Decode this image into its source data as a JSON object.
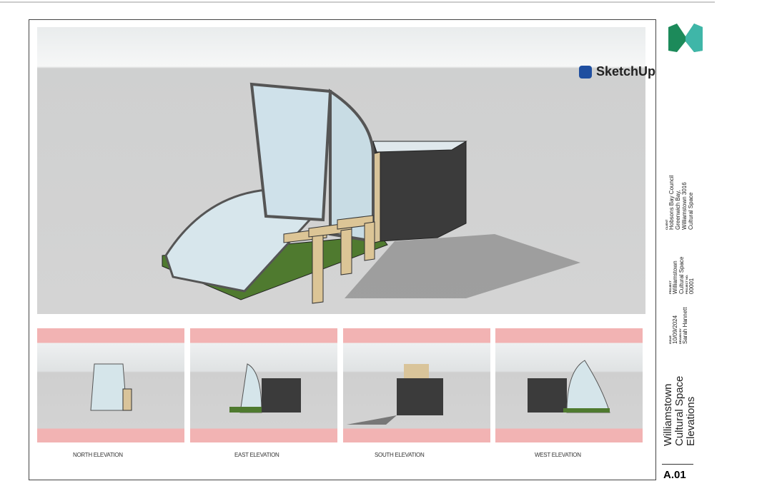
{
  "viewport": {
    "brand": "SketchUp"
  },
  "thumbnails": [
    {
      "label": "NORTH ELEVATION"
    },
    {
      "label": "EAST ELEVATION"
    },
    {
      "label": "SOUTH ELEVATION"
    },
    {
      "label": "WEST ELEVATION"
    }
  ],
  "title_block": {
    "client_caption": "CLIENT",
    "client": [
      "Hobsons Bay Council",
      "Greenwich Bay,",
      "Williamstown 3016",
      "Cultural Space"
    ],
    "project_caption": "PROJECT",
    "project": [
      "Williamstown",
      "Cultural Space"
    ],
    "project_no_caption": "PROJECT NO.",
    "project_no": "00001",
    "issue_caption": "ISSUE",
    "issue": "10/09/2024",
    "drawn_caption": "DRAWN BY",
    "drawn": "Sarah Hannett",
    "title": [
      "Williamstown",
      "Cultural Space",
      "Elevations"
    ],
    "sheet": "A.01"
  },
  "colors": {
    "logo_green": "#1c8a5a",
    "logo_teal": "#3fb6a8",
    "salmon": "#f2b3b3",
    "timber": "#d9c49a",
    "dark": "#3a3a3a"
  }
}
